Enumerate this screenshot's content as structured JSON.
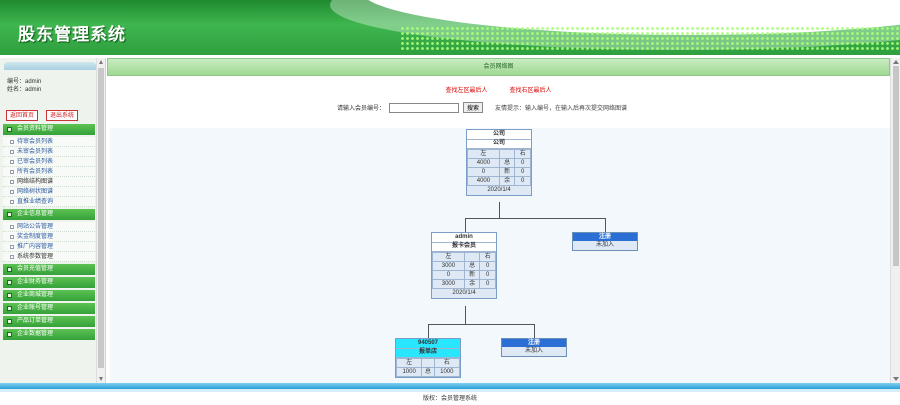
{
  "header": {
    "title": "股东管理系统"
  },
  "user": {
    "account_label": "编号：admin",
    "name_label": "姓名：admin"
  },
  "sidebar": {
    "buttons": [
      "返回首页",
      "退出系统"
    ],
    "groups": [
      {
        "label": "会员资料管理",
        "items": [
          "待审会员列表",
          "未审会员列表",
          "已审会员列表",
          "所有会员列表",
          "网络结构图谱",
          "网络树状图谱",
          "直推业绩查询"
        ]
      },
      {
        "label": "企业信息管理",
        "items": [
          "网站公告管理",
          "奖金制度管理",
          "推广内容管理",
          "系统参数管理"
        ]
      },
      {
        "label": "会员充值管理",
        "items": []
      },
      {
        "label": "企业财务管理",
        "items": []
      },
      {
        "label": "企业商城管理",
        "items": []
      },
      {
        "label": "企业账号管理",
        "items": []
      },
      {
        "label": "产品订单管理",
        "items": []
      },
      {
        "label": "企业数据管理",
        "items": []
      }
    ]
  },
  "main": {
    "title": "会员网络图",
    "links": [
      "查找左区最后人",
      "查找右区最后人"
    ],
    "search": {
      "label": "请输入会员编号：",
      "button": "搜索",
      "tip": "友情提示：输入编号，在输入后再次提交网络图谱"
    }
  },
  "tree": {
    "root": {
      "id": "公司",
      "name": "公司",
      "left_label": "左",
      "right_label": "右",
      "rows": [
        [
          "4000",
          "总",
          "0"
        ],
        [
          "0",
          "新",
          "0"
        ],
        [
          "4000",
          "余",
          "0"
        ]
      ],
      "date": "2020/1/4"
    },
    "level1": {
      "id": "admin",
      "name": "报卡会员",
      "left_label": "左",
      "right_label": "右",
      "rows": [
        [
          "3000",
          "总",
          "0"
        ],
        [
          "0",
          "新",
          "0"
        ],
        [
          "3000",
          "余",
          "0"
        ]
      ],
      "date": "2020/1/4"
    },
    "level1_reg": {
      "title": "注册",
      "status": "未加入"
    },
    "level2": {
      "id": "940507",
      "name": "报单店",
      "left_label": "左",
      "right_label": "右",
      "rows": [
        [
          "1000",
          "总",
          "1000"
        ]
      ]
    },
    "level2_reg": {
      "title": "注册",
      "status": "未加入"
    }
  },
  "footer": {
    "copyright": "版权：会员管理系统"
  }
}
